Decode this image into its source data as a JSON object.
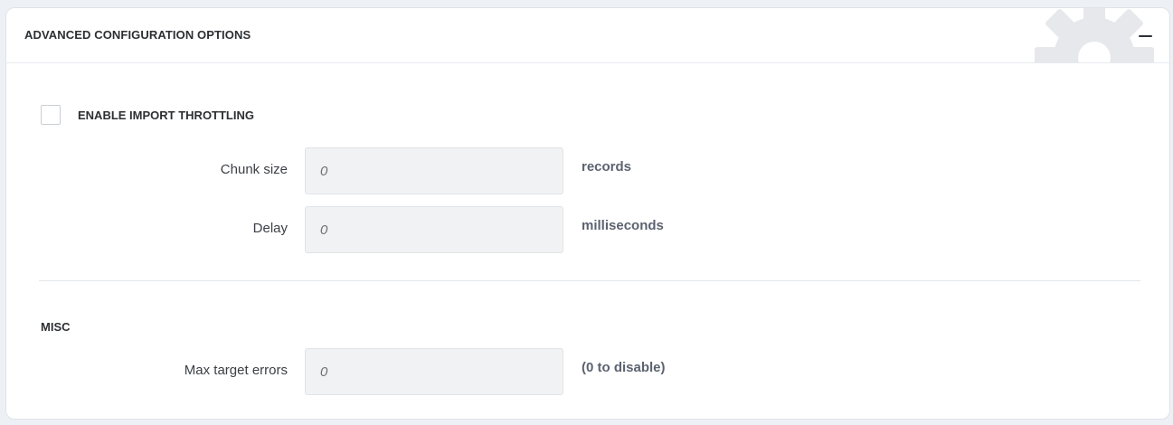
{
  "panel": {
    "title": "ADVANCED CONFIGURATION OPTIONS",
    "collapse_icon": "minus-icon",
    "background_icon": "gear-icon"
  },
  "throttling": {
    "checkbox_label": "ENABLE IMPORT THROTTLING",
    "checked": false,
    "fields": [
      {
        "label": "Chunk size",
        "placeholder": "0",
        "unit": "records"
      },
      {
        "label": "Delay",
        "placeholder": "0",
        "unit": "milliseconds"
      }
    ]
  },
  "misc": {
    "title": "MISC",
    "fields": [
      {
        "label": "Max target errors",
        "placeholder": "0",
        "unit": "(0 to disable)"
      }
    ]
  },
  "colors": {
    "text_dark": "#2c2f33",
    "unit_text": "#5c6370",
    "input_bg": "#f1f2f3",
    "gear": "#e6e8eb"
  }
}
